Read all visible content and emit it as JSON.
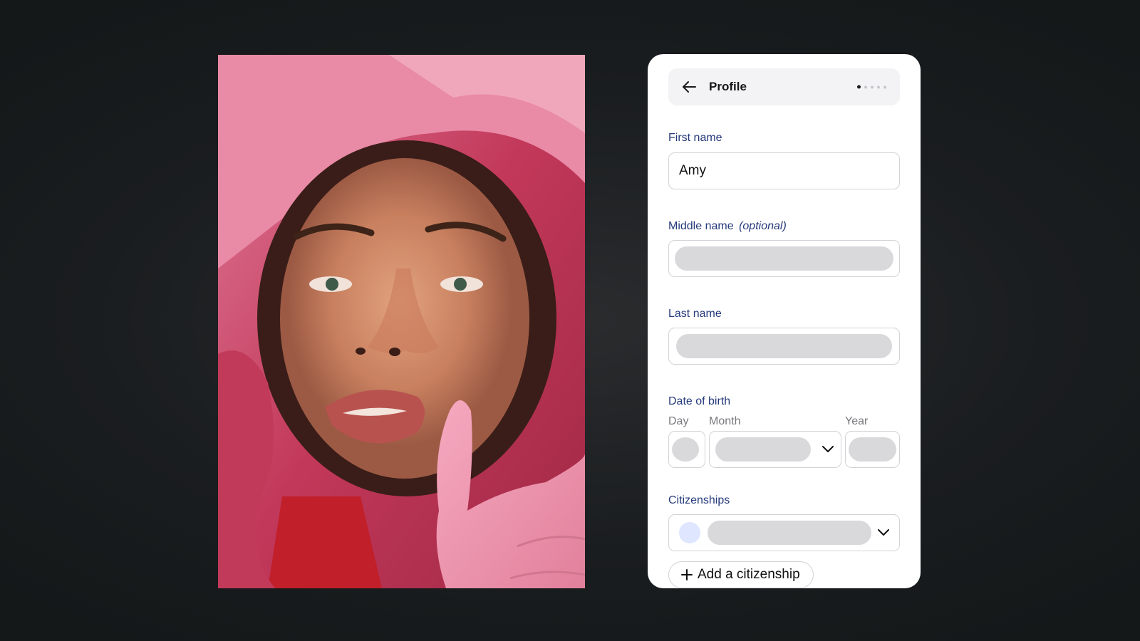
{
  "photo": {
    "subject": "portrait-woman-pink-hood-glove"
  },
  "header": {
    "title": "Profile",
    "step_count": 5,
    "active_step": 1
  },
  "fields": {
    "first_name": {
      "label": "First name",
      "value": "Amy"
    },
    "middle_name": {
      "label": "Middle name",
      "optional_note": "(optional)"
    },
    "last_name": {
      "label": "Last name"
    },
    "date_of_birth": {
      "label": "Date of birth",
      "day_label": "Day",
      "month_label": "Month",
      "year_label": "Year"
    },
    "citizenships": {
      "label": "Citizenships"
    }
  },
  "actions": {
    "add_citizenship": "Add a citizenship"
  },
  "colors": {
    "label_blue": "#24397a",
    "skeleton": "#d9d8db",
    "flag_placeholder": "#dfe6ff"
  }
}
